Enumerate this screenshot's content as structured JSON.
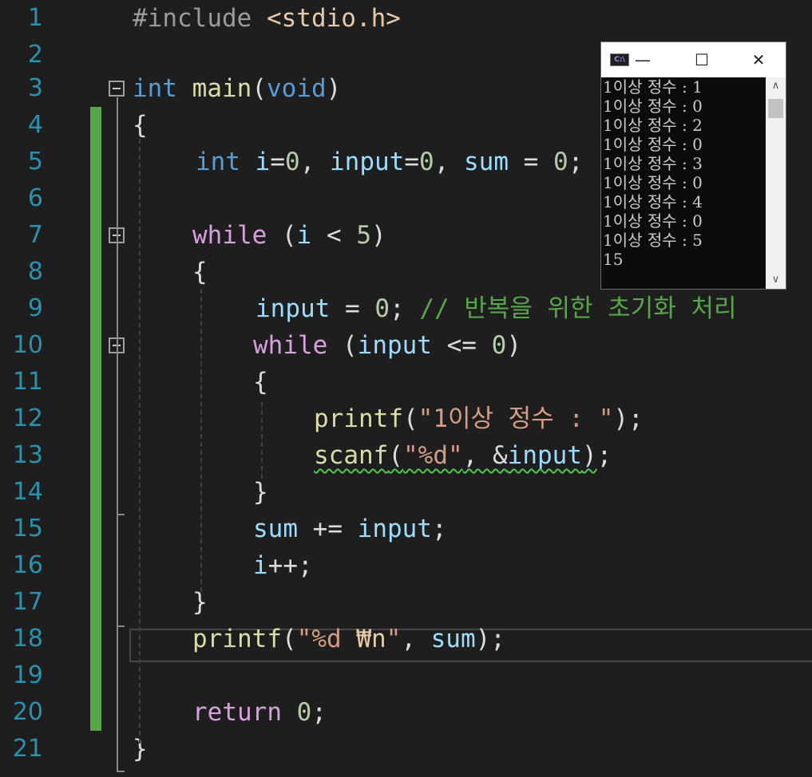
{
  "editor": {
    "lines": [
      {
        "num": "1",
        "tokens": [
          {
            "t": "#include ",
            "c": "pre"
          },
          {
            "t": "<stdio.h>",
            "c": "inc"
          }
        ]
      },
      {
        "num": "2",
        "tokens": []
      },
      {
        "num": "3",
        "tokens": [
          {
            "t": "int",
            "c": "kw"
          },
          {
            "t": " ",
            "c": ""
          },
          {
            "t": "main",
            "c": "fn"
          },
          {
            "t": "(",
            "c": ""
          },
          {
            "t": "void",
            "c": "kw"
          },
          {
            "t": ")",
            "c": ""
          }
        ]
      },
      {
        "num": "4",
        "tokens": [
          {
            "t": "{",
            "c": ""
          }
        ]
      },
      {
        "num": "5",
        "tokens": [
          {
            "t": "int",
            "c": "kw"
          },
          {
            "t": " ",
            "c": ""
          },
          {
            "t": "i",
            "c": "var"
          },
          {
            "t": "=",
            "c": ""
          },
          {
            "t": "0",
            "c": "num"
          },
          {
            "t": ", ",
            "c": ""
          },
          {
            "t": "input",
            "c": "var"
          },
          {
            "t": "=",
            "c": ""
          },
          {
            "t": "0",
            "c": "num"
          },
          {
            "t": ", ",
            "c": ""
          },
          {
            "t": "sum",
            "c": "var"
          },
          {
            "t": " = ",
            "c": ""
          },
          {
            "t": "0",
            "c": "num"
          },
          {
            "t": ";",
            "c": ""
          }
        ]
      },
      {
        "num": "6",
        "tokens": []
      },
      {
        "num": "7",
        "tokens": [
          {
            "t": "while",
            "c": "ctl"
          },
          {
            "t": " (",
            "c": ""
          },
          {
            "t": "i",
            "c": "var"
          },
          {
            "t": " < ",
            "c": ""
          },
          {
            "t": "5",
            "c": "num"
          },
          {
            "t": ")",
            "c": ""
          }
        ]
      },
      {
        "num": "8",
        "tokens": [
          {
            "t": "{",
            "c": ""
          }
        ]
      },
      {
        "num": "9",
        "tokens": [
          {
            "t": "input",
            "c": "var"
          },
          {
            "t": " = ",
            "c": ""
          },
          {
            "t": "0",
            "c": "num"
          },
          {
            "t": "; ",
            "c": ""
          },
          {
            "t": "// 반복을 위한 초기화 처리",
            "c": "com"
          }
        ]
      },
      {
        "num": "10",
        "tokens": [
          {
            "t": "while",
            "c": "ctl"
          },
          {
            "t": " (",
            "c": ""
          },
          {
            "t": "input",
            "c": "var"
          },
          {
            "t": " <= ",
            "c": ""
          },
          {
            "t": "0",
            "c": "num"
          },
          {
            "t": ")",
            "c": ""
          }
        ]
      },
      {
        "num": "11",
        "tokens": [
          {
            "t": "{",
            "c": ""
          }
        ]
      },
      {
        "num": "12",
        "tokens": [
          {
            "t": "printf",
            "c": "fn"
          },
          {
            "t": "(",
            "c": ""
          },
          {
            "t": "\"1이상 정수 : \"",
            "c": "str"
          },
          {
            "t": ");",
            "c": ""
          }
        ]
      },
      {
        "num": "13",
        "tokens": [
          {
            "t": "scanf",
            "c": "fn",
            "sq": true
          },
          {
            "t": "(",
            "c": "",
            "sq": true
          },
          {
            "t": "\"%d\"",
            "c": "str",
            "sq": true
          },
          {
            "t": ", &",
            "c": "",
            "sq": true
          },
          {
            "t": "input",
            "c": "var",
            "sq": true
          },
          {
            "t": ")",
            "c": "",
            "sq": true
          },
          {
            "t": ";",
            "c": ""
          }
        ]
      },
      {
        "num": "14",
        "tokens": [
          {
            "t": "}",
            "c": ""
          }
        ]
      },
      {
        "num": "15",
        "tokens": [
          {
            "t": "sum",
            "c": "var"
          },
          {
            "t": " += ",
            "c": ""
          },
          {
            "t": "input",
            "c": "var"
          },
          {
            "t": ";",
            "c": ""
          }
        ]
      },
      {
        "num": "16",
        "tokens": [
          {
            "t": "i",
            "c": "var"
          },
          {
            "t": "++;",
            "c": ""
          }
        ]
      },
      {
        "num": "17",
        "tokens": [
          {
            "t": "}",
            "c": ""
          }
        ]
      },
      {
        "num": "18",
        "tokens": [
          {
            "t": "printf",
            "c": "fn"
          },
          {
            "t": "(",
            "c": ""
          },
          {
            "t": "\"%d ",
            "c": "str"
          },
          {
            "t": "₩n",
            "c": "esc"
          },
          {
            "t": "\"",
            "c": "str"
          },
          {
            "t": ", ",
            "c": ""
          },
          {
            "t": "sum",
            "c": "var"
          },
          {
            "t": ");",
            "c": ""
          }
        ]
      },
      {
        "num": "19",
        "tokens": []
      },
      {
        "num": "20",
        "tokens": [
          {
            "t": "return",
            "c": "ctl"
          },
          {
            "t": " ",
            "c": ""
          },
          {
            "t": "0",
            "c": "num"
          },
          {
            "t": ";",
            "c": ""
          }
        ]
      },
      {
        "num": "21",
        "tokens": [
          {
            "t": "}",
            "c": ""
          }
        ]
      }
    ]
  },
  "console": {
    "icon_label": "C:\\",
    "minimize_glyph": "—",
    "maximize_glyph": "☐",
    "close_glyph": "✕",
    "scroll_up_glyph": "∧",
    "scroll_down_glyph": "∨",
    "lines": [
      "1이상 정수 : 1",
      "1이상 정수 : 0",
      "1이상 정수 : 2",
      "1이상 정수 : 0",
      "1이상 정수 : 3",
      "1이상 정수 : 0",
      "1이상 정수 : 4",
      "1이상 정수 : 0",
      "1이상 정수 : 5",
      "15"
    ]
  },
  "colors": {
    "editor_bg": "#1e1e1e",
    "line_number": "#2b91af",
    "change_bar": "#57a64a",
    "keyword": "#569cd6",
    "control": "#d8a0df",
    "function": "#dcdcaa",
    "variable": "#9cdcfe",
    "number": "#b5cea8",
    "string": "#d69d85",
    "comment": "#57a64a"
  },
  "icons": {
    "fold": "fold-collapse-icon",
    "console_app": "console-app-icon",
    "minimize": "minimize-icon",
    "maximize": "maximize-icon",
    "close": "close-icon"
  }
}
